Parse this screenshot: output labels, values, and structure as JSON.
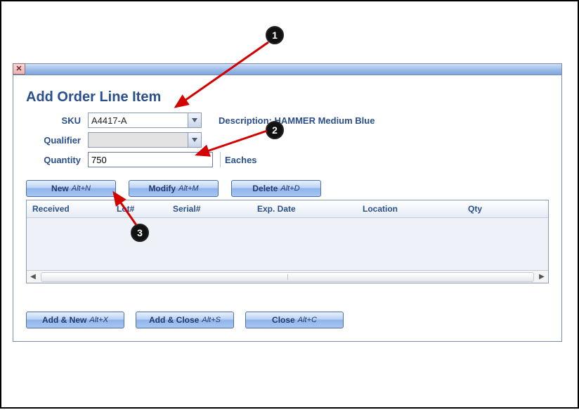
{
  "window": {
    "title_heading": "Add Order Line Item"
  },
  "form": {
    "sku_label": "SKU",
    "sku_value": "A4417-A",
    "description_label": "Description:",
    "description_value": "HAMMER Medium Blue",
    "qualifier_label": "Qualifier",
    "qualifier_value": "",
    "quantity_label": "Quantity",
    "quantity_value": "750",
    "uom_label": "Eaches"
  },
  "actions": {
    "new_label": "New",
    "new_hotkey": "Alt+N",
    "modify_label": "Modify",
    "modify_hotkey": "Alt+M",
    "delete_label": "Delete",
    "delete_hotkey": "Alt+D"
  },
  "grid": {
    "columns": {
      "received": "Received",
      "lot": "Lot#",
      "serial": "Serial#",
      "exp": "Exp. Date",
      "location": "Location",
      "qty": "Qty"
    }
  },
  "footer": {
    "add_new_label": "Add & New",
    "add_new_hotkey": "Alt+X",
    "add_close_label": "Add & Close",
    "add_close_hotkey": "Alt+S",
    "close_label": "Close",
    "close_hotkey": "Alt+C"
  },
  "annotations": {
    "b1": "1",
    "b2": "2",
    "b3": "3"
  }
}
